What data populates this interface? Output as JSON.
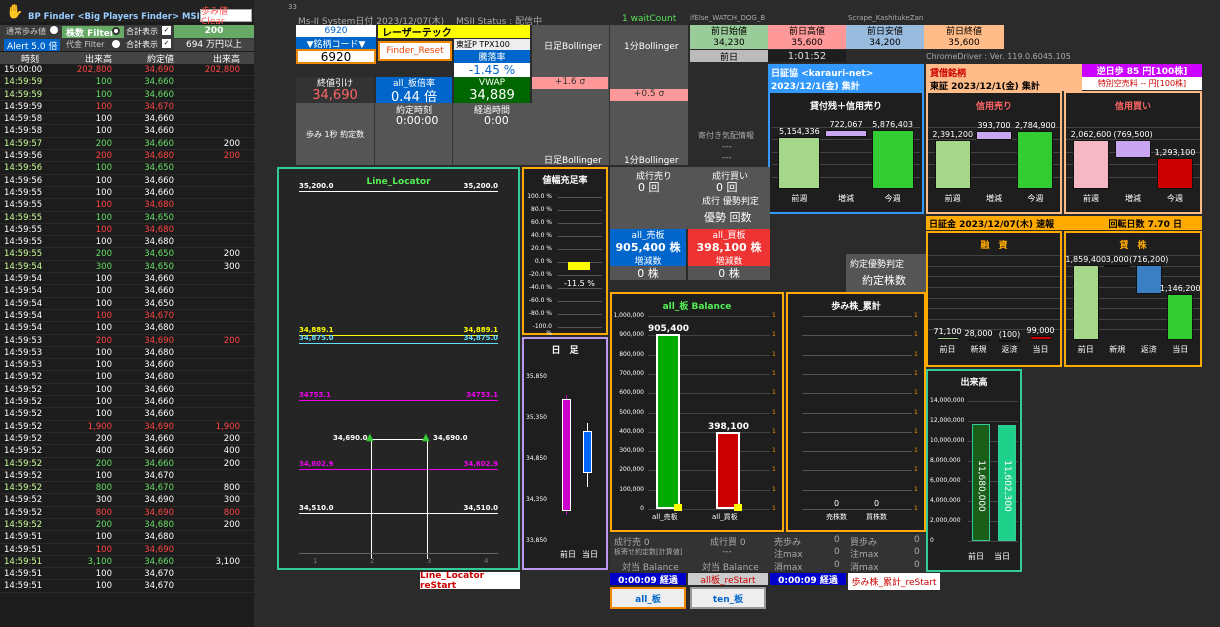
{
  "header": {
    "app_title": "BP Finder <Big Players Finder> MSII RSS",
    "clear_button": "歩み値Clear",
    "sys_date": "Ms-II System日付 2023/12/07(木)",
    "msii_status": "MSII Status : 配信中",
    "wait_count": "1 waitCount",
    "watch_dog": "ifElse_WATCH_DOG_B",
    "scrape": "Scrape_KashitukeZan",
    "page_num": "33"
  },
  "filters": {
    "normal": "通常歩み値",
    "share_filter": "株数 Filter",
    "sum_show1": "合計表示",
    "share_val": "200",
    "alert": "Alert 5.0 倍",
    "amount_filter": "代金 Filter",
    "sum_show2": "合計表示",
    "amount_val": "694 万円以上"
  },
  "ticker": {
    "headers": [
      "時刻",
      "出来高",
      "約定値",
      "出来高"
    ],
    "rows": [
      [
        "15:00:00",
        "202,800",
        "34,690",
        "202,800",
        "r"
      ],
      [
        "14:59:59",
        "100",
        "34,660",
        "",
        "g"
      ],
      [
        "14:59:59",
        "100",
        "34,660",
        "",
        "g"
      ],
      [
        "14:59:59",
        "100",
        "34,670",
        "",
        "r"
      ],
      [
        "14:59:58",
        "100",
        "34,660",
        "",
        "w"
      ],
      [
        "14:59:58",
        "100",
        "34,660",
        "",
        "w"
      ],
      [
        "14:59:57",
        "200",
        "34,660",
        "200",
        "g"
      ],
      [
        "14:59:56",
        "200",
        "34,680",
        "200",
        "r"
      ],
      [
        "14:59:56",
        "100",
        "34,650",
        "",
        "g"
      ],
      [
        "14:59:56",
        "100",
        "34,660",
        "",
        "w"
      ],
      [
        "14:59:55",
        "100",
        "34,660",
        "",
        "w"
      ],
      [
        "14:59:55",
        "100",
        "34,680",
        "",
        "r"
      ],
      [
        "14:59:55",
        "100",
        "34,650",
        "",
        "g"
      ],
      [
        "14:59:55",
        "100",
        "34,680",
        "",
        "r"
      ],
      [
        "14:59:55",
        "100",
        "34,680",
        "",
        "w"
      ],
      [
        "14:59:55",
        "200",
        "34,650",
        "200",
        "g"
      ],
      [
        "14:59:54",
        "300",
        "34,650",
        "300",
        "g"
      ],
      [
        "14:59:54",
        "100",
        "34,660",
        "",
        "w"
      ],
      [
        "14:59:54",
        "100",
        "34,660",
        "",
        "w"
      ],
      [
        "14:59:54",
        "100",
        "34,650",
        "",
        "w"
      ],
      [
        "14:59:54",
        "100",
        "34,670",
        "",
        "r"
      ],
      [
        "14:59:54",
        "100",
        "34,680",
        "",
        "w"
      ],
      [
        "14:59:53",
        "200",
        "34,690",
        "200",
        "r"
      ],
      [
        "14:59:53",
        "100",
        "34,680",
        "",
        "w"
      ],
      [
        "14:59:53",
        "100",
        "34,660",
        "",
        "w"
      ],
      [
        "14:59:52",
        "100",
        "34,680",
        "",
        "w"
      ],
      [
        "14:59:52",
        "100",
        "34,660",
        "",
        "w"
      ],
      [
        "14:59:52",
        "100",
        "34,660",
        "",
        "w"
      ],
      [
        "14:59:52",
        "100",
        "34,660",
        "",
        "w"
      ],
      [
        "14:59:52",
        "1,900",
        "34,690",
        "1,900",
        "r"
      ],
      [
        "14:59:52",
        "200",
        "34,660",
        "200",
        "w"
      ],
      [
        "14:59:52",
        "400",
        "34,660",
        "400",
        "w"
      ],
      [
        "14:59:52",
        "200",
        "34,660",
        "200",
        "g"
      ],
      [
        "14:59:52",
        "100",
        "34,670",
        "",
        "w"
      ],
      [
        "14:59:52",
        "800",
        "34,670",
        "800",
        "g"
      ],
      [
        "14:59:52",
        "300",
        "34,690",
        "300",
        "w"
      ],
      [
        "14:59:52",
        "800",
        "34,690",
        "800",
        "r"
      ],
      [
        "14:59:52",
        "200",
        "34,680",
        "200",
        "g"
      ],
      [
        "14:59:51",
        "100",
        "34,680",
        "",
        "w"
      ],
      [
        "14:59:51",
        "100",
        "34,690",
        "",
        "r"
      ],
      [
        "14:59:51",
        "3,100",
        "34,660",
        "3,100",
        "g"
      ],
      [
        "14:59:51",
        "100",
        "34,670",
        "",
        "w"
      ],
      [
        "14:59:51",
        "100",
        "34,670",
        "",
        "w"
      ]
    ]
  },
  "stock": {
    "code": "6920",
    "code_label": "▼銘柄コード▼",
    "code_input": "6920",
    "name": "レーザーテック",
    "finder_reset": "Finder_Reset",
    "index_label": "東証P TPX100",
    "change_label": "騰落率",
    "change_val": "-1.45 %",
    "bb_daily": "日足Bollinger",
    "bb_1min": "1分Bollinger",
    "bb_plus16": "+1.6 σ",
    "bb_plus05": "+0.5 σ",
    "close_label": "終値引け",
    "close_val": "34,690",
    "board_ratio_label": "all_板倍率",
    "board_ratio_val": "0.44 倍",
    "vwap_label": "VWAP",
    "vwap_val": "34,889",
    "exec_time_label": "約定時刻",
    "exec_time": "0:00:00",
    "elapsed_label": "経過時間",
    "elapsed": "0:00",
    "ayumi_label": "歩み 1秒 約定数",
    "yoritsuki": "寄付き気配情報",
    "dash1": "---",
    "dash2": "---"
  },
  "prev": {
    "open_label": "前日始値",
    "open": "34,230",
    "high_label": "前日高値",
    "high": "35,600",
    "low_label": "前日安値",
    "low": "34,200",
    "close_label": "前日終値",
    "close": "35,600",
    "day_label": "前日",
    "time": "1:01:52",
    "driver": "ChromeDriver : Ver. 119.0.6045.105"
  },
  "nisshokyo": {
    "title": "日証協 <karauri-net>",
    "date": "2023/12/1(金) 集計",
    "chart_title": "貸付残＋信用売り",
    "values": [
      "5,154,336",
      "722,067",
      "5,876,403"
    ],
    "labels": [
      "前週",
      "増減",
      "今週"
    ]
  },
  "taishaku": {
    "title": "貸借銘柄",
    "sub": "東証 2023/12/1(金) 集計",
    "gyakuhibu": "逆日歩 85 円[100株]",
    "special": "特別空売料 -- 円[100株]"
  },
  "shinyo_uri": {
    "title": "信用売り",
    "values": [
      "2,391,200",
      "393,700",
      "2,784,900"
    ],
    "labels": [
      "前週",
      "増減",
      "今週"
    ]
  },
  "shinyo_kai": {
    "title": "信用買い",
    "values": [
      "2,062,600",
      "(769,500)",
      "1,293,100"
    ],
    "labels": [
      "前週",
      "増減",
      "今週"
    ]
  },
  "nisshokin": {
    "title": "日証金 2023/12/07(木) 速報",
    "turnover": "回転日数 7.70 日"
  },
  "yushi": {
    "title": "融　資",
    "values": [
      "71,100",
      "28,000",
      "(100)",
      "99,000"
    ],
    "labels": [
      "前日",
      "新規",
      "返済",
      "当日"
    ]
  },
  "kashikabu": {
    "title": "貸　株",
    "values": [
      "1,859,400",
      "3,000",
      "(716,200)",
      "1,146,200"
    ],
    "labels": [
      "前日",
      "新規",
      "返済",
      "当日"
    ]
  },
  "dekidaka": {
    "title": "出来高",
    "values": [
      "11,680,000",
      "11,602,300"
    ],
    "labels": [
      "前日",
      "当日"
    ],
    "axis": [
      "14,000,000",
      "12,000,000",
      "10,000,000",
      "8,000,000",
      "6,000,000",
      "4,000,000",
      "2,000,000",
      "0"
    ]
  },
  "locator": {
    "title": "Line_Locator",
    "top_l": "35,200.0",
    "top_r": "35,200.0",
    "l1": "34,889.1",
    "l1r": "34,889.1",
    "l2": "34,875.0",
    "l2r": "34,875.0",
    "l3": "34753.1",
    "l3r": "34753.1",
    "l4": "34,690.0",
    "l4r": "34,690.0",
    "l5": "34,602.9",
    "l5r": "34,602.9",
    "l6": "34,510.0",
    "l6r": "34,510.0",
    "restart": "Line_Locator reStart",
    "ticks": [
      "1",
      "2",
      "3",
      "4"
    ]
  },
  "nehaba": {
    "title": "値幅充足率",
    "axis": [
      "100.0 %",
      "80.0 %",
      "60.0 %",
      "40.0 %",
      "20.0 %",
      "0.0 %",
      "-20.0 %",
      "-40.0 %",
      "-60.0 %",
      "-80.0 %",
      "-100.0 %"
    ],
    "val": "-11.5 %"
  },
  "hiashi": {
    "title": "日　足",
    "axis": [
      "35,850",
      "35,350",
      "34,850",
      "34,350",
      "33,850"
    ],
    "labels": [
      "前日",
      "当日"
    ]
  },
  "seiko": {
    "uri_label": "成行売り",
    "uri": "0 回",
    "kai_label": "成行買い",
    "kai": "0 回",
    "yusen": "成行 優勢判定",
    "yusen_val": "優勢 回数"
  },
  "ita": {
    "uri_label": "all_売板",
    "uri": "905,400 株",
    "kai_label": "all_買板",
    "kai": "398,100 株",
    "zou1": "増減数",
    "zou2": "増減数",
    "z1": "0 株",
    "z2": "0 株",
    "yakujo_label": "約定優勢判定",
    "yakujo": "約定株数"
  },
  "balance": {
    "title": "all_板 Balance",
    "values": [
      "905,400",
      "398,100"
    ],
    "labels": [
      "all_売板",
      "all_買板"
    ],
    "axis": [
      "1,000,000",
      "900,000",
      "800,000",
      "700,000",
      "600,000",
      "500,000",
      "400,000",
      "300,000",
      "200,000",
      "100,000",
      "0"
    ]
  },
  "ayumi": {
    "title": "歩み株_累計",
    "values": [
      "0",
      "0"
    ],
    "labels": [
      "売株数",
      "買株数"
    ],
    "restart": "歩み株_累計_reStart"
  },
  "bottom": {
    "seiko_uri": "成行売 0",
    "seiko_kai": "成行買 0",
    "mizaisei": "板寄せ約定数[計算値]",
    "dash": "---",
    "taito": "対当 Balance",
    "taito2": "対当 Balance",
    "elapsed1": "0:00:09 経過",
    "restart1": "all板_reStart",
    "elapsed2": "0:00:09 経過",
    "btn_all": "all_板",
    "btn_ten": "ten_板",
    "uri_ayumi": "売歩み",
    "kai_ayumi": "買歩み",
    "chumax": "注max",
    "chumax2": "注max",
    "shomax": "消max",
    "shomax2": "消max",
    "zero": "0"
  }
}
